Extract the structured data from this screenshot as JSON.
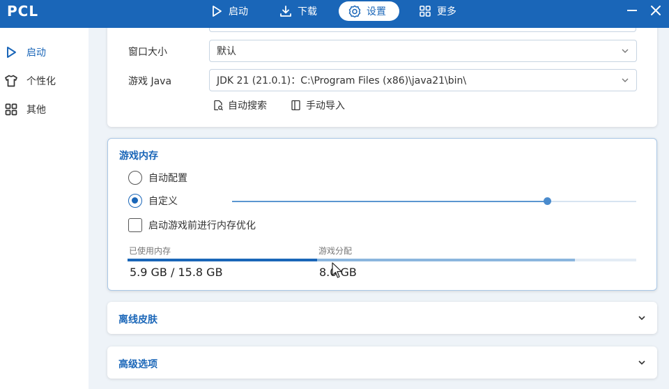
{
  "app": {
    "title": "PCL"
  },
  "topnav": {
    "items": [
      {
        "label": "启动",
        "icon": "play-icon"
      },
      {
        "label": "下载",
        "icon": "download-icon"
      },
      {
        "label": "设置",
        "icon": "gear-icon",
        "active": true
      },
      {
        "label": "更多",
        "icon": "grid-icon"
      }
    ]
  },
  "window_controls": {
    "minimize": "minimize-icon",
    "close": "close-icon"
  },
  "sidebar": {
    "items": [
      {
        "label": "启动",
        "icon": "play-icon",
        "active": true
      },
      {
        "label": "个性化",
        "icon": "shirt-icon"
      },
      {
        "label": "其他",
        "icon": "grid-icon"
      }
    ]
  },
  "launch_settings": {
    "window_size": {
      "label": "窗口大小",
      "value": "默认"
    },
    "java": {
      "label": "游戏 Java",
      "value": "JDK 21 (21.0.1)：C:\\Program Files (x86)\\java21\\bin\\"
    },
    "buttons": {
      "auto_search": "自动搜索",
      "manual_import": "手动导入"
    }
  },
  "memory": {
    "title": "游戏内存",
    "options": {
      "auto": "自动配置",
      "custom": "自定义"
    },
    "selected": "custom",
    "slider_fraction": 0.78,
    "optimize_label": "启动游戏前进行内存优化",
    "optimize_checked": false,
    "used_label": "已使用内存",
    "used_value": "5.9 GB / 15.8 GB",
    "used_fraction": 0.373,
    "alloc_label": "游戏分配",
    "alloc_value": "8.0 GB",
    "alloc_fraction": 0.506
  },
  "sections": {
    "offline_skin": "离线皮肤",
    "advanced": "高级选项"
  },
  "colors": {
    "accent": "#1a66b8",
    "background": "#eef3f8"
  }
}
